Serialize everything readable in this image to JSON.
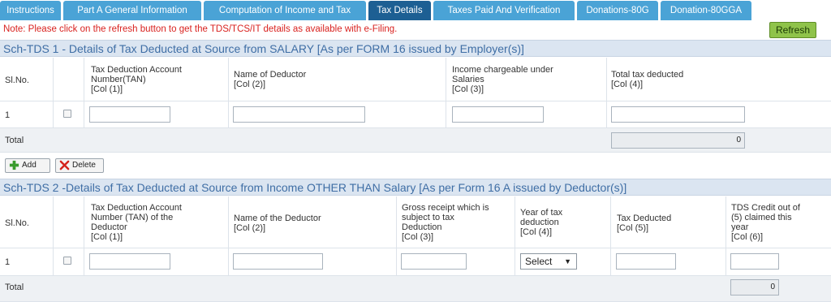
{
  "tabs": [
    {
      "label": "Instructions",
      "active": false
    },
    {
      "label": "Part A General Information",
      "active": false
    },
    {
      "label": "Computation of Income and Tax",
      "active": false
    },
    {
      "label": "Tax Details",
      "active": true
    },
    {
      "label": "Taxes Paid And Verification",
      "active": false
    },
    {
      "label": "Donations-80G",
      "active": false
    },
    {
      "label": "Donation-80GGA",
      "active": false
    }
  ],
  "note": {
    "text": "Note: Please click on the refresh button to get the TDS/TCS/IT details as available with e-Filing.",
    "refresh_label": "Refresh"
  },
  "tds1": {
    "title": "Sch-TDS 1 - Details of Tax Deducted at Source from SALARY [As per FORM 16 issued by Employer(s)]",
    "headers": {
      "slno": "Sl.No.",
      "tan": [
        "Tax Deduction Account",
        "Number(TAN)",
        "[Col (1)]"
      ],
      "deductor": [
        "Name of Deductor",
        "[Col (2)]"
      ],
      "income": [
        "Income chargeable under",
        "Salaries",
        "[Col (3)]"
      ],
      "total_tax": [
        "Total tax deducted",
        "[Col (4)]"
      ]
    },
    "row_number": "1",
    "total_label": "Total",
    "total_value": "0"
  },
  "actions": {
    "add_label": "Add",
    "delete_label": "Delete"
  },
  "tds2": {
    "title": "Sch-TDS 2 -Details of Tax Deducted at Source from Income OTHER THAN Salary [As per Form 16 A issued by Deductor(s)]",
    "headers": {
      "slno": "Sl.No.",
      "tan": [
        "Tax Deduction Account",
        "Number (TAN) of the",
        "Deductor",
        "[Col (1)]"
      ],
      "deductor": [
        "Name of the Deductor",
        "[Col (2)]"
      ],
      "gross": [
        "Gross receipt which is",
        "subject to tax",
        "Deduction",
        "[Col (3)]"
      ],
      "year": [
        "Year of tax",
        "deduction",
        "[Col (4)]"
      ],
      "tax_deducted": [
        "Tax Deducted",
        "[Col (5)]"
      ],
      "tds_credit": [
        "TDS Credit out of",
        "(5) claimed this",
        "year",
        "[Col (6)]"
      ]
    },
    "row_number": "1",
    "year_select_value": "Select",
    "total_label": "Total",
    "total_value": "0"
  }
}
